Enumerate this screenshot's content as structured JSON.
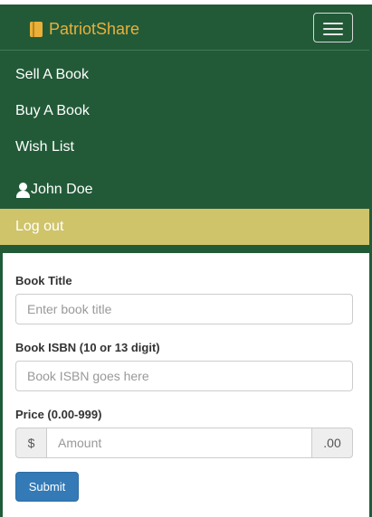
{
  "navbar": {
    "brand": "PatriotShare",
    "toggle_icon": "hamburger-icon",
    "items": [
      {
        "label": "Sell A Book"
      },
      {
        "label": "Buy A Book"
      },
      {
        "label": "Wish List"
      }
    ],
    "user": {
      "icon": "user-icon",
      "name": "John Doe"
    },
    "logout_label": "Log out"
  },
  "form": {
    "title_label": "Book Title",
    "title_placeholder": "Enter book title",
    "isbn_label": "Book ISBN (10 or 13 digit)",
    "isbn_placeholder": "Book ISBN goes here",
    "price_label": "Price (0.00-999)",
    "price_prefix": "$",
    "price_placeholder": "Amount",
    "price_suffix": ".00",
    "submit_label": "Submit"
  },
  "colors": {
    "navbar_bg": "#225a38",
    "brand": "#e9b03a",
    "logout_bg": "#cfc46a",
    "submit_bg": "#337ab7"
  }
}
